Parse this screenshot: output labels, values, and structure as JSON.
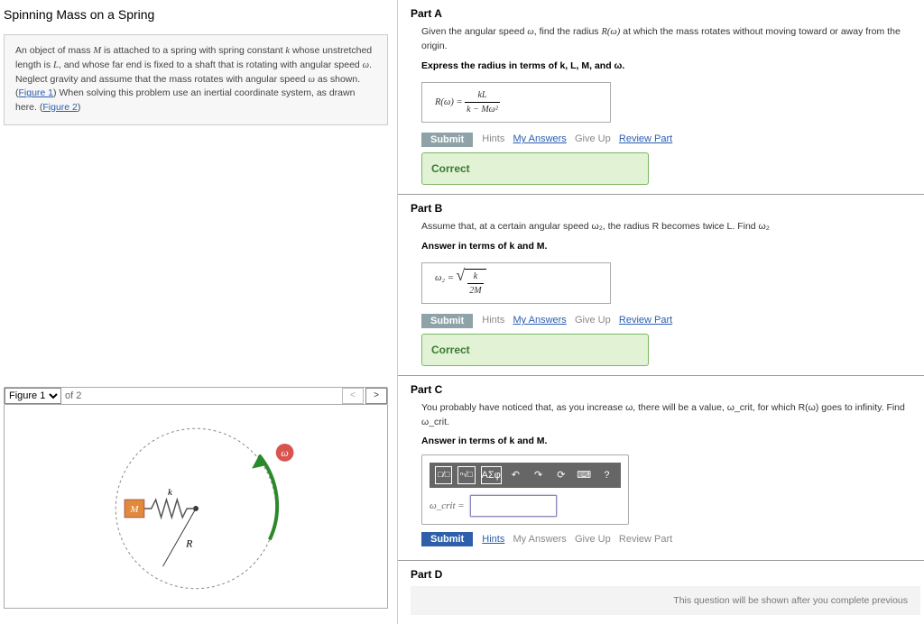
{
  "title": "Spinning Mass on a Spring",
  "description": {
    "text_prefix": "An object of mass ",
    "M": "M",
    "t1": " is attached to a spring with spring constant ",
    "k": "k",
    "t2": " whose unstretched length is ",
    "L": "L",
    "t3": ", and whose far end is fixed to a shaft that is rotating with angular speed ",
    "w": "ω",
    "t4": ". Neglect gravity and assume that the mass rotates with angular speed ",
    "t5": " as shown. (",
    "fig1": "Figure 1",
    "t6": ") When solving this problem use an inertial coordinate system, as drawn here. (",
    "fig2": "Figure 2",
    "t7": ")"
  },
  "figure_selector": {
    "selected": "Figure 1",
    "count_label": "of 2"
  },
  "figure_labels": {
    "M": "M",
    "k": "k",
    "R": "R",
    "w": "ω"
  },
  "partA": {
    "label": "Part A",
    "prompt_1": "Given the angular speed ",
    "w": "ω",
    "prompt_2": ", find the radius ",
    "Rw": "R(ω)",
    "prompt_3": " at which the mass rotates without moving toward or away from the origin.",
    "instruction": "Express the radius in terms of k, L, M, and ω.",
    "answer_lhs": "R(ω) = ",
    "answer_num": "kL",
    "answer_den": "k − Mω²",
    "correct": "Correct"
  },
  "partB": {
    "label": "Part B",
    "prompt": "Assume that, at a certain angular speed ω₂, the radius R becomes twice L. Find ω₂",
    "instruction": "Answer in terms of k and M.",
    "answer_lhs": "ω₂ = ",
    "answer_num": "k",
    "answer_den": "2M",
    "correct": "Correct"
  },
  "partC": {
    "label": "Part C",
    "prompt": "You probably have noticed that, as you increase ω, there will be a value, ω_crit, for which R(ω) goes to infinity. Find ω_crit.",
    "instruction": "Answer in terms of k and M.",
    "field_label": "ω_crit ="
  },
  "partD": {
    "label": "Part D",
    "pending": "This question will be shown after you complete previous"
  },
  "action_buttons": {
    "submit": "Submit",
    "hints": "Hints",
    "my_answers": "My Answers",
    "give_up": "Give Up",
    "review_part": "Review Part"
  },
  "toolbar": {
    "frac": "□/□",
    "root": "ⁿ√□",
    "greek": "ΑΣφ",
    "undo": "↶",
    "redo": "↷",
    "reset": "⟳",
    "keyboard": "⌨",
    "help": "?"
  }
}
